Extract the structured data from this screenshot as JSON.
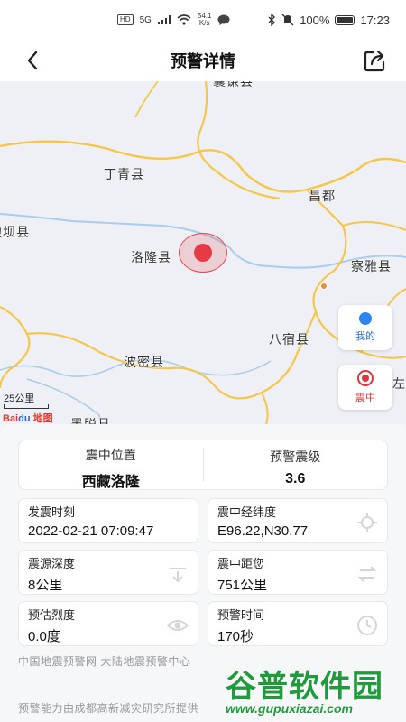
{
  "status_bar": {
    "hd_badge": "HD",
    "signal": "5G",
    "net_speed_value": "54.1",
    "net_speed_unit": "K/s",
    "battery": "100%",
    "time": "17:23"
  },
  "nav": {
    "title": "预警详情",
    "back_icon": "chevron-left-icon",
    "share_icon": "share-icon"
  },
  "map": {
    "places": {
      "top_cut": "囊谦县",
      "dingqing": "丁青县",
      "changdu": "昌都",
      "bianba": "边坝县",
      "luolong": "洛隆县",
      "chaya": "察雅县",
      "basu": "八宿县",
      "bomi": "波密县",
      "zuogong": "左贡",
      "bottom_cut": "墨脱县"
    },
    "scale_label": "25公里",
    "logo_text_bai": "Bai",
    "logo_text_du": "du",
    "logo_text_map": "地图",
    "buttons": {
      "mine": "我的",
      "center": "震中"
    },
    "colors": {
      "road": "#f5c94e",
      "river": "#9cc8f0",
      "epicenter": "#e63b45"
    }
  },
  "summary": {
    "location_label": "震中位置",
    "location_value": "西藏洛隆",
    "level_label": "预警震级",
    "level_value": "3.6"
  },
  "details": {
    "time_label": "发震时刻",
    "time_value": "2022-02-21 07:09:47",
    "coords_label": "震中经纬度",
    "coords_value": "E96.22,N30.77",
    "depth_label": "震源深度",
    "depth_value": "8公里",
    "distance_label": "震中距您",
    "distance_value": "751公里",
    "intensity_label": "预估烈度",
    "intensity_value": "0.0度",
    "warn_time_label": "预警时间",
    "warn_time_value": "170秒"
  },
  "footer": {
    "source": "中国地震预警网 大陆地震预警中心",
    "powered": "预警能力由成都高新减灾研究所提供"
  },
  "watermark": {
    "title": "谷普软件园",
    "url": "www.gupuxiazai.com"
  }
}
